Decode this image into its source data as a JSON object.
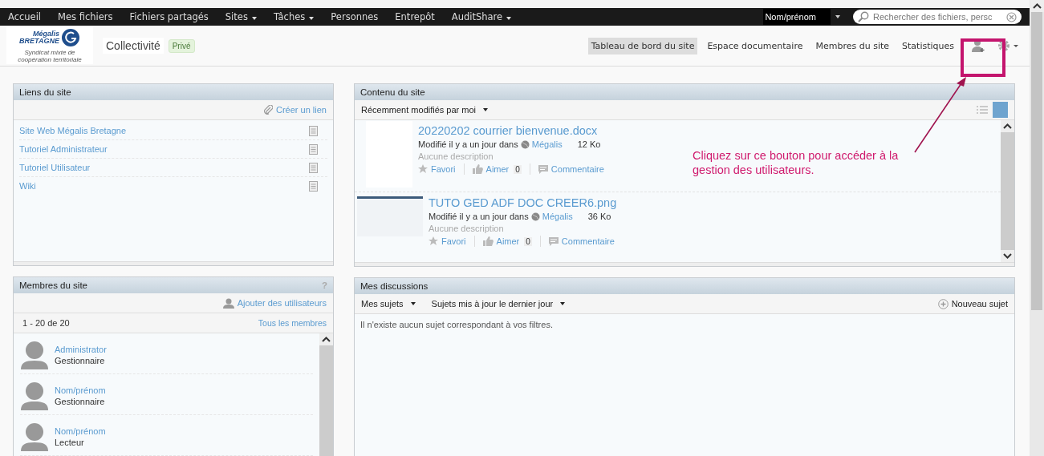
{
  "nav": {
    "items": [
      {
        "label": "Accueil",
        "dropdown": false
      },
      {
        "label": "Mes fichiers",
        "dropdown": false
      },
      {
        "label": "Fichiers partagés",
        "dropdown": false
      },
      {
        "label": "Sites",
        "dropdown": true
      },
      {
        "label": "Tâches",
        "dropdown": true
      },
      {
        "label": "Personnes",
        "dropdown": false
      },
      {
        "label": "Entrepôt",
        "dropdown": false
      },
      {
        "label": "AuditShare",
        "dropdown": true
      }
    ],
    "user": "Nom/prénom",
    "search": {
      "placeholder": "Rechercher des fichiers, persc"
    }
  },
  "header": {
    "logo": {
      "line1": "Mégalis",
      "line2": "BRETAGNE",
      "subtitle": "Syndicat mixte de coopération territoriale"
    },
    "site_title": "Collectivité",
    "visibility": "Privé",
    "site_nav": [
      {
        "label": "Tableau de bord du site",
        "selected": true
      },
      {
        "label": "Espace documentaire",
        "selected": false
      },
      {
        "label": "Membres du site",
        "selected": false
      },
      {
        "label": "Statistiques",
        "selected": false
      }
    ]
  },
  "links_panel": {
    "title": "Liens du site",
    "action": "Créer un lien",
    "links": [
      "Site Web Mégalis Bretagne",
      "Tutoriel Administrateur",
      "Tutoriel Utilisateur",
      "Wiki"
    ]
  },
  "members_panel": {
    "title": "Membres du site",
    "help": "?",
    "action": "Ajouter des utilisateurs",
    "count": "1 - 20 de 20",
    "all_link": "Tous les membres",
    "members": [
      {
        "name": "Administrator",
        "role": "Gestionnaire"
      },
      {
        "name": "Nom/prénom",
        "role": "Gestionnaire"
      },
      {
        "name": "Nom/prénom",
        "role": "Lecteur"
      }
    ]
  },
  "content_panel": {
    "title": "Contenu du site",
    "filter": "Récemment modifiés par moi",
    "documents": [
      {
        "name": "20220202 courrier bienvenue.docx",
        "kind": "doc",
        "modified": "Modifié il y a un jour dans",
        "site": "Mégalis",
        "size": "12 Ko",
        "description": "Aucune description",
        "favorite": "Favori",
        "like": "Aimer",
        "likes": "0",
        "comment": "Commentaire"
      },
      {
        "name": "TUTO GED ADF DOC CREER6.png",
        "kind": "screenshot",
        "modified": "Modifié il y a un jour dans",
        "site": "Mégalis",
        "size": "36 Ko",
        "description": "Aucune description",
        "favorite": "Favori",
        "like": "Aimer",
        "likes": "0",
        "comment": "Commentaire"
      }
    ]
  },
  "discussions_panel": {
    "title": "Mes discussions",
    "filters": [
      "Mes sujets",
      "Sujets mis à jour le dernier jour"
    ],
    "new_topic": "Nouveau sujet",
    "empty": "Il n'existe aucun sujet correspondant à vos filtres."
  },
  "annotation": {
    "text": "Cliquez sur ce bouton pour accéder à la gestion des utilisateurs."
  }
}
